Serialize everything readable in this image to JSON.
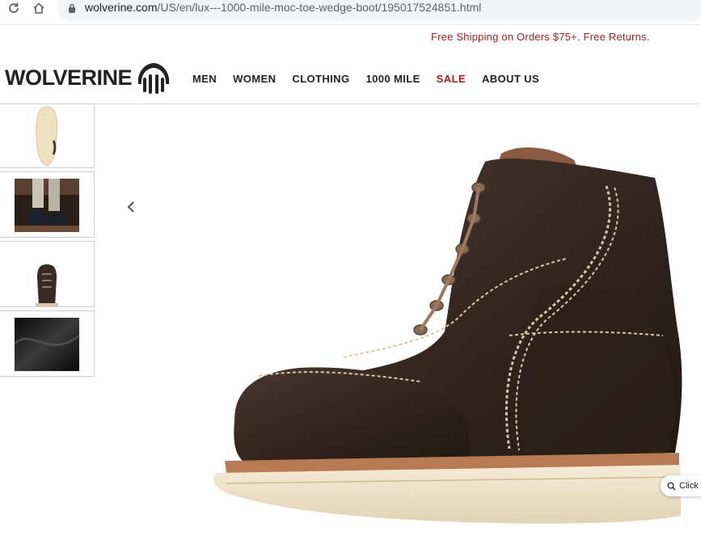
{
  "browser": {
    "url_domain": "wolverine.com",
    "url_path": "/US/en/lux---1000-mile-moc-toe-wedge-boot/195017524851.html"
  },
  "promo": {
    "text": "Free Shipping on Orders $75+. Free Returns."
  },
  "header": {
    "logo_text": "WOLVERINE",
    "nav": [
      {
        "label": "MEN"
      },
      {
        "label": "WOMEN"
      },
      {
        "label": "CLOTHING"
      },
      {
        "label": "1000 MILE"
      },
      {
        "label": "SALE"
      },
      {
        "label": "ABOUT US"
      }
    ]
  },
  "gallery": {
    "thumbnails": [
      "sole",
      "lifestyle",
      "front",
      "leather-detail"
    ],
    "zoom_label": "Click"
  },
  "colors": {
    "sale": "#a11f24",
    "promo": "#a11f24",
    "boot_leather": "#3a2a24"
  }
}
